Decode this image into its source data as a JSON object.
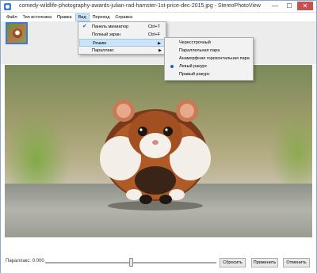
{
  "window": {
    "title": "comedy-wildlife-photography-awards-julian-rad-hamster-1st-price-dec-2015.jpg - StereoPhotoView",
    "min_glyph": "—",
    "max_glyph": "☐",
    "close_glyph": "✕"
  },
  "menubar": {
    "items": [
      {
        "label": "Файл"
      },
      {
        "label": "Тип источника"
      },
      {
        "label": "Правка"
      },
      {
        "label": "Вид"
      },
      {
        "label": "Переход"
      },
      {
        "label": "Справка"
      }
    ]
  },
  "view_menu": {
    "items": [
      {
        "label": "Панель миниатюр",
        "shortcut": "Ctrl+T",
        "checked": true
      },
      {
        "label": "Полный экран",
        "shortcut": "Ctrl+F"
      },
      {
        "label": "Режим",
        "submenu_arrow": "▶"
      },
      {
        "label": "Параллакс",
        "submenu_arrow": "▶"
      }
    ]
  },
  "mode_submenu": {
    "items": [
      {
        "label": "Чересстрочный"
      },
      {
        "label": "Параллельная пара"
      },
      {
        "label": "Анаморфная горизонтальная пара"
      },
      {
        "label": "Левый ракурс",
        "selected": true
      },
      {
        "label": "Правый ракурс"
      }
    ]
  },
  "controls": {
    "parallax_label": "Параллакс: 0.000",
    "slider_value_fraction": 0.5,
    "reset_label": "Сбросить",
    "apply_label": "Применить",
    "cancel_label": "Отменить"
  },
  "colors": {
    "accent": "#3a7bd5",
    "menu_highlight": "#cce4f7",
    "close_button": "#c75050"
  }
}
